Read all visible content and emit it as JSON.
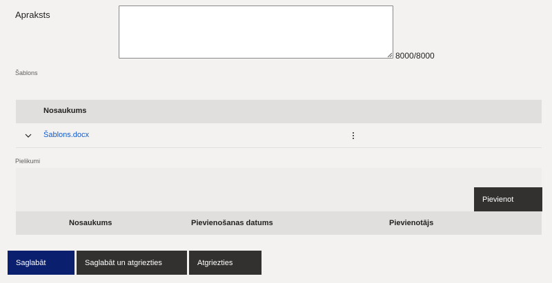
{
  "description": {
    "label": "Apraksts",
    "value": "",
    "counter": "8000/8000"
  },
  "template_section": {
    "label": "Šablons",
    "column_name": "Nosaukums",
    "rows": [
      {
        "name": "Šablons.docx"
      }
    ]
  },
  "attachments_section": {
    "label": "Pielikumi",
    "add_button": "Pievienot",
    "columns": [
      "Nosaukums",
      "Pievienošanas datums",
      "Pievienotājs"
    ]
  },
  "actions": {
    "save": "Saglabāt",
    "save_and_return": "Saglabāt un atgriezties",
    "return": "Atgriezties"
  },
  "colors": {
    "primary": "#0a1f6e",
    "dark_button": "#323130",
    "link": "#0f5ad0"
  }
}
